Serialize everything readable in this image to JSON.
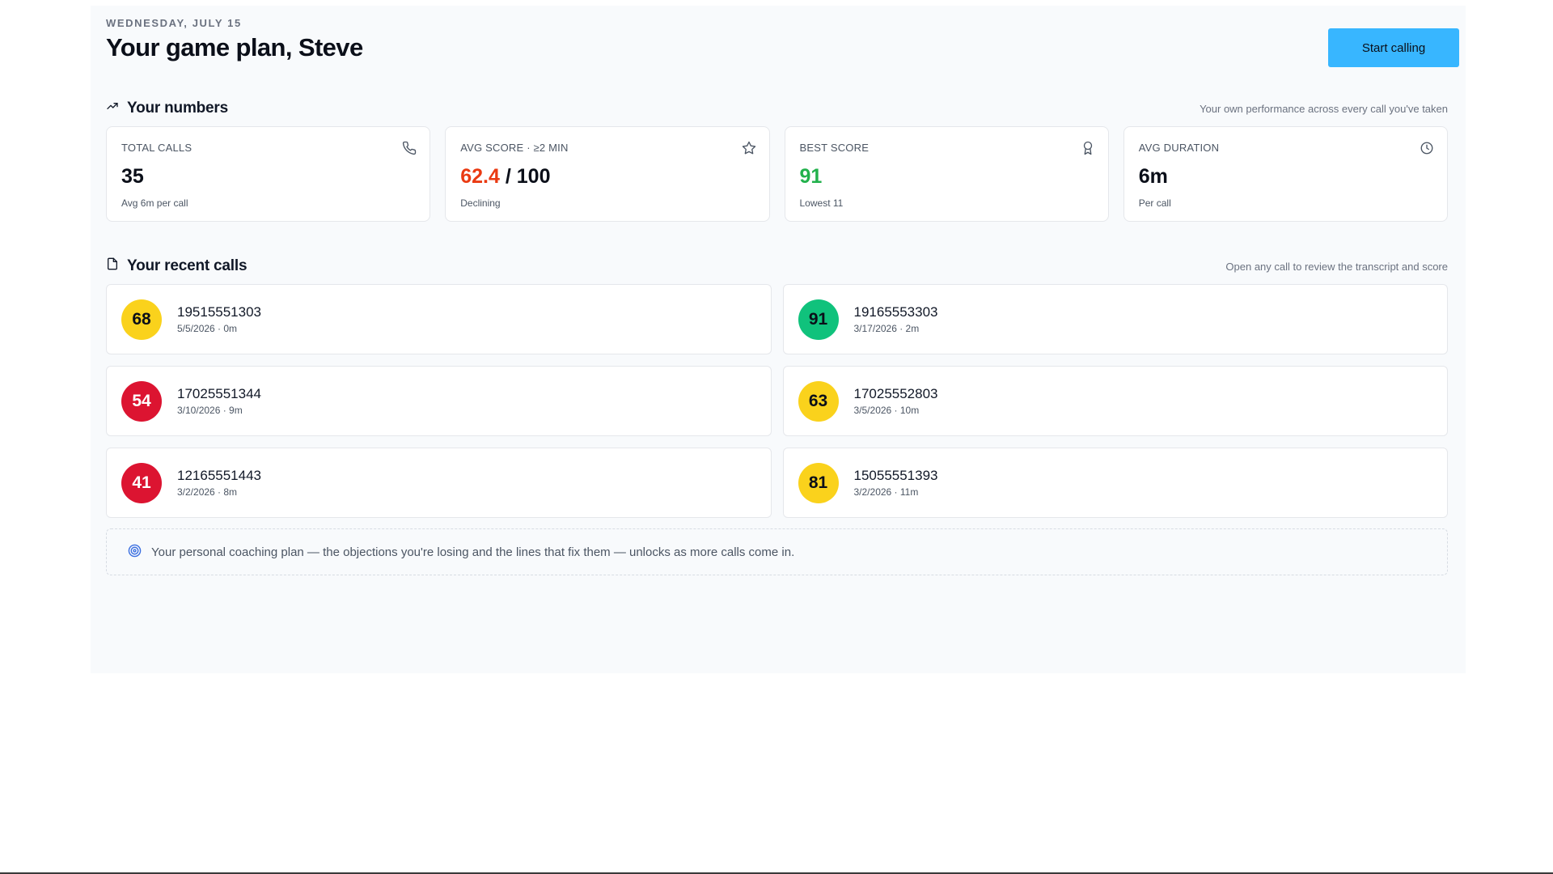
{
  "header": {
    "date": "WEDNESDAY, JULY 15",
    "title": "Your game plan, Steve",
    "start_button": "Start calling"
  },
  "numbers": {
    "heading": "Your numbers",
    "note": "Your own performance across every call you've taken",
    "icon": "trending-up-icon",
    "stats": [
      {
        "label": "TOTAL CALLS",
        "value": "35",
        "sub": "Avg 6m per call",
        "icon": "phone-icon"
      },
      {
        "label": "AVG SCORE · ≥2 MIN",
        "value": "62.4",
        "value_suffix": " / 100",
        "sub": "Declining",
        "icon": "star-icon",
        "value_color": "#ea3a12"
      },
      {
        "label": "BEST SCORE",
        "value": "91",
        "sub": "Lowest 11",
        "icon": "award-icon",
        "value_color": "#22b14c"
      },
      {
        "label": "AVG DURATION",
        "value": "6m",
        "sub": "Per call",
        "icon": "clock-icon"
      }
    ]
  },
  "recent": {
    "heading": "Your recent calls",
    "note": "Open any call to review the transcript and score",
    "icon": "document-icon",
    "calls": [
      {
        "score": "68",
        "phone": "19515551303",
        "meta": "5/5/2026 · 0m",
        "color": "#fad21c"
      },
      {
        "score": "91",
        "phone": "19165553303",
        "meta": "3/17/2026 · 2m",
        "color": "#10c27c"
      },
      {
        "score": "54",
        "phone": "17025551344",
        "meta": "3/10/2026 · 9m",
        "color": "#dc1431"
      },
      {
        "score": "63",
        "phone": "17025552803",
        "meta": "3/5/2026 · 10m",
        "color": "#fad21c"
      },
      {
        "score": "41",
        "phone": "12165551443",
        "meta": "3/2/2026 · 8m",
        "color": "#dc1431"
      },
      {
        "score": "81",
        "phone": "15055551393",
        "meta": "3/2/2026 · 11m",
        "color": "#fad21c"
      }
    ]
  },
  "coaching": {
    "icon": "target-icon",
    "text": "Your personal coaching plan — the objections you're losing and the lines that fix them — unlocks as more calls come in."
  }
}
